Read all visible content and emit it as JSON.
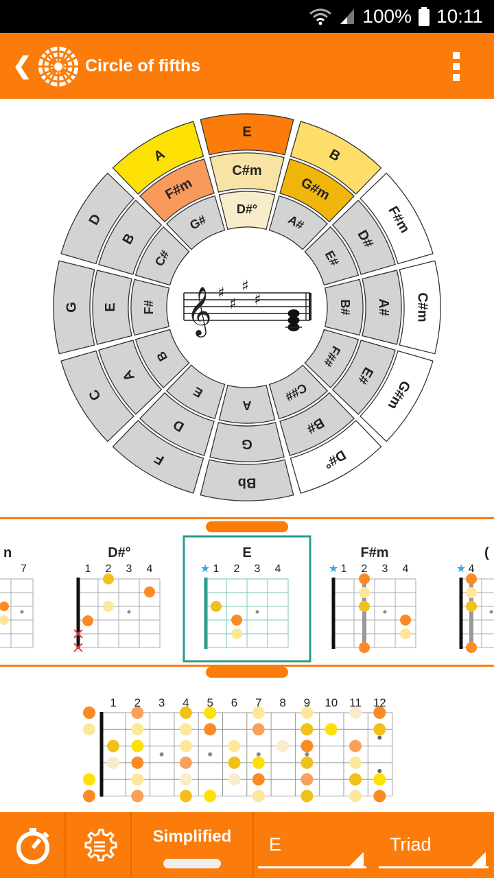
{
  "status": {
    "battery": "100%",
    "time": "10:11"
  },
  "appbar": {
    "back": "❮",
    "title": "Circle of fifths"
  },
  "wheel": {
    "outer": [
      {
        "label": "E",
        "color": "#fb7c0b"
      },
      {
        "label": "B",
        "color": "#fede6a"
      },
      {
        "label": "F#m",
        "color": "#ffffff"
      },
      {
        "label": "C#m",
        "color": "#ffffff"
      },
      {
        "label": "G#m",
        "color": "#ffffff"
      },
      {
        "label": "D#°",
        "color": "#ffffff"
      },
      {
        "label": "Bb",
        "color": "#d3d3d3"
      },
      {
        "label": "F",
        "color": "#d3d3d3"
      },
      {
        "label": "C",
        "color": "#d3d3d3"
      },
      {
        "label": "G",
        "color": "#d3d3d3"
      },
      {
        "label": "D",
        "color": "#d3d3d3"
      },
      {
        "label": "A",
        "color": "#fde105"
      }
    ],
    "middle": [
      {
        "label": "C#m",
        "color": "#f7e3a6"
      },
      {
        "label": "G#m",
        "color": "#f1b60c"
      },
      {
        "label": "D#",
        "color": "#d3d3d3"
      },
      {
        "label": "A#",
        "color": "#d3d3d3"
      },
      {
        "label": "E#",
        "color": "#d3d3d3"
      },
      {
        "label": "B#",
        "color": "#d3d3d3"
      },
      {
        "label": "G",
        "color": "#d3d3d3"
      },
      {
        "label": "D",
        "color": "#d3d3d3"
      },
      {
        "label": "A",
        "color": "#d3d3d3"
      },
      {
        "label": "E",
        "color": "#d3d3d3"
      },
      {
        "label": "B",
        "color": "#d3d3d3"
      },
      {
        "label": "F#m",
        "color": "#f89a5a"
      }
    ],
    "inner": [
      {
        "label": "D#°",
        "color": "#f9eccb"
      },
      {
        "label": "A#",
        "color": "#d3d3d3"
      },
      {
        "label": "E#",
        "color": "#d3d3d3"
      },
      {
        "label": "B#",
        "color": "#d3d3d3"
      },
      {
        "label": "F##",
        "color": "#d3d3d3"
      },
      {
        "label": "C##",
        "color": "#d3d3d3"
      },
      {
        "label": "A",
        "color": "#d3d3d3"
      },
      {
        "label": "E",
        "color": "#d3d3d3"
      },
      {
        "label": "B",
        "color": "#d3d3d3"
      },
      {
        "label": "F#",
        "color": "#d3d3d3"
      },
      {
        "label": "C#",
        "color": "#d3d3d3"
      },
      {
        "label": "G#",
        "color": "#d3d3d3"
      }
    ]
  },
  "chords": [
    {
      "name": "n",
      "frets": [
        "7"
      ]
    },
    {
      "name": "D#°",
      "frets": [
        "1",
        "2",
        "3",
        "4"
      ]
    },
    {
      "name": "E",
      "frets": [
        "1",
        "2",
        "3",
        "4"
      ]
    },
    {
      "name": "F#m",
      "frets": [
        "1",
        "2",
        "3",
        "4"
      ]
    },
    {
      "name": "(",
      "frets": [
        "4"
      ]
    }
  ],
  "fretboard": {
    "numbers": [
      "1",
      "2",
      "3",
      "4",
      "5",
      "6",
      "7",
      "8",
      "9",
      "10",
      "11",
      "12"
    ]
  },
  "bottombar": {
    "mode": "Simplified",
    "key": "E",
    "type": "Triad"
  }
}
